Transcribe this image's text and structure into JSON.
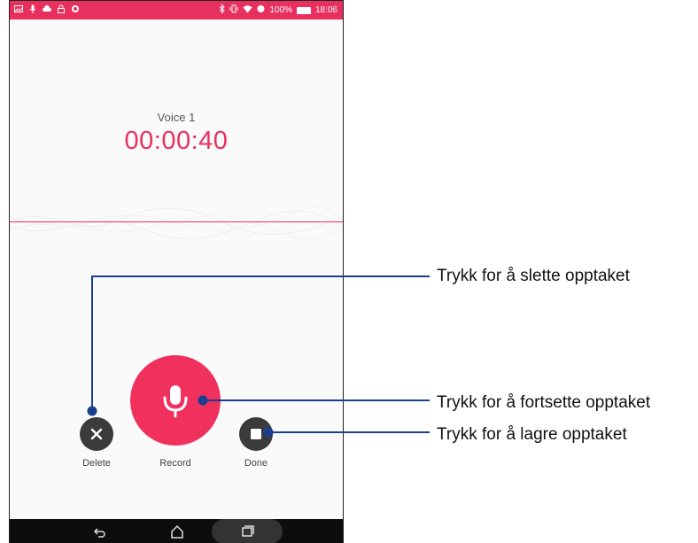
{
  "status_bar": {
    "time": "18:06",
    "battery": "100%",
    "accent": "#e8305f"
  },
  "recorder": {
    "title": "Voice 1",
    "timer": "00:00:40"
  },
  "controls": {
    "delete_label": "Delete",
    "record_label": "Record",
    "done_label": "Done"
  },
  "callouts": {
    "delete": "Trykk for å slette opptaket",
    "record": "Trykk for å fortsette opptaket",
    "done": "Trykk for å lagre opptaket"
  },
  "icons": {
    "delete": "close-icon",
    "record": "microphone-icon",
    "done": "stop-icon",
    "nav_back": "back-icon",
    "nav_home": "home-icon",
    "nav_recent": "recent-apps-icon"
  }
}
